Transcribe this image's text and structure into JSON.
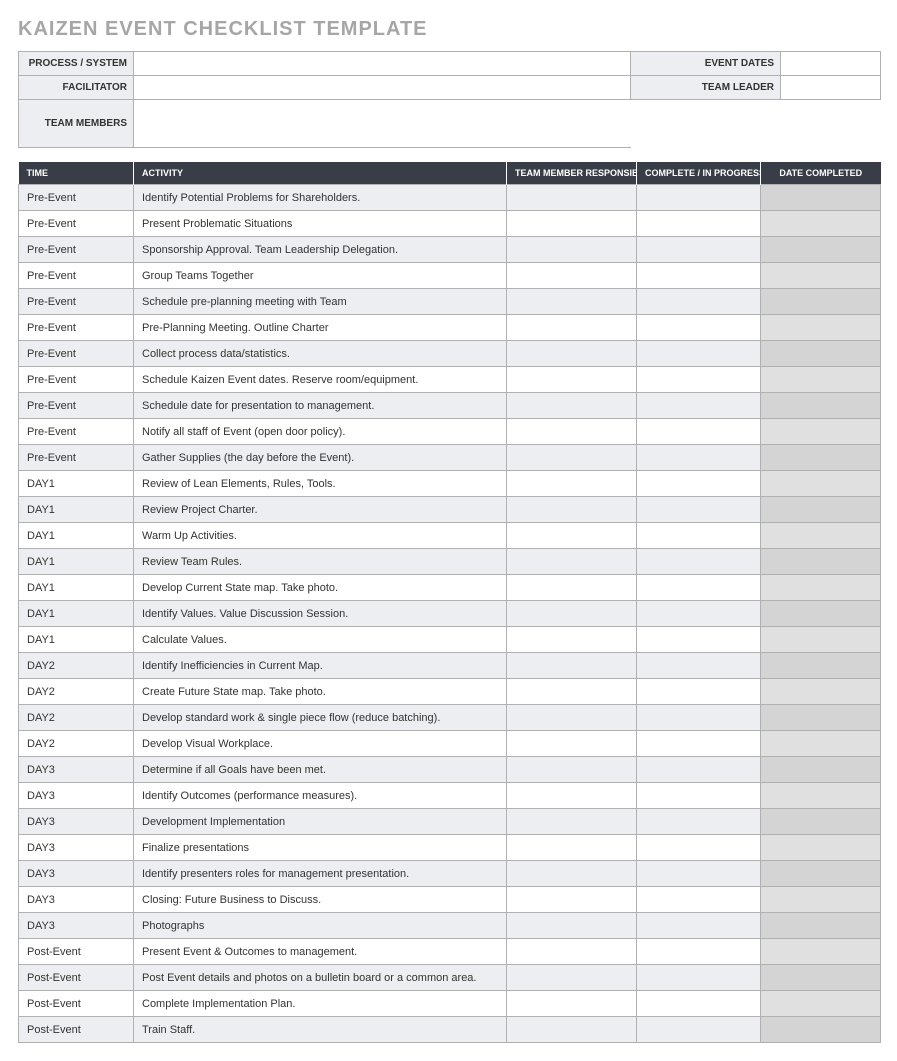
{
  "title": "KAIZEN EVENT CHECKLIST TEMPLATE",
  "info": {
    "labels": {
      "process": "PROCESS / SYSTEM",
      "dates": "EVENT DATES",
      "facilitator": "FACILITATOR",
      "leader": "TEAM LEADER",
      "members": "TEAM MEMBERS"
    },
    "values": {
      "process": "",
      "dates": "",
      "facilitator": "",
      "leader": "",
      "members": ""
    }
  },
  "columns": {
    "time": "TIME",
    "activity": "ACTIVITY",
    "responsible": "TEAM MEMBER RESPONSIBLE",
    "complete": "COMPLETE / IN PROGRESS",
    "date": "DATE COMPLETED"
  },
  "rows": [
    {
      "time": "Pre-Event",
      "activity": "Identify Potential Problems for Shareholders."
    },
    {
      "time": "Pre-Event",
      "activity": "Present Problematic Situations"
    },
    {
      "time": "Pre-Event",
      "activity": "Sponsorship Approval. Team Leadership Delegation."
    },
    {
      "time": "Pre-Event",
      "activity": "Group Teams Together"
    },
    {
      "time": "Pre-Event",
      "activity": "Schedule pre-planning meeting with Team"
    },
    {
      "time": "Pre-Event",
      "activity": "Pre-Planning Meeting. Outline Charter"
    },
    {
      "time": "Pre-Event",
      "activity": "Collect process data/statistics."
    },
    {
      "time": "Pre-Event",
      "activity": "Schedule Kaizen Event dates. Reserve room/equipment."
    },
    {
      "time": "Pre-Event",
      "activity": "Schedule date for presentation to management."
    },
    {
      "time": "Pre-Event",
      "activity": "Notify all staff of Event (open door policy)."
    },
    {
      "time": "Pre-Event",
      "activity": "Gather Supplies (the day before the Event)."
    },
    {
      "time": "DAY1",
      "activity": "Review of Lean Elements, Rules, Tools."
    },
    {
      "time": "DAY1",
      "activity": "Review Project Charter."
    },
    {
      "time": "DAY1",
      "activity": "Warm Up Activities."
    },
    {
      "time": "DAY1",
      "activity": "Review Team Rules."
    },
    {
      "time": "DAY1",
      "activity": "Develop Current State map. Take photo."
    },
    {
      "time": "DAY1",
      "activity": "Identify Values. Value Discussion Session."
    },
    {
      "time": "DAY1",
      "activity": "Calculate Values."
    },
    {
      "time": "DAY2",
      "activity": "Identify Inefficiencies in Current Map."
    },
    {
      "time": "DAY2",
      "activity": "Create Future State map. Take photo."
    },
    {
      "time": "DAY2",
      "activity": "Develop standard work & single piece flow (reduce batching)."
    },
    {
      "time": "DAY2",
      "activity": "Develop Visual Workplace."
    },
    {
      "time": "DAY3",
      "activity": "Determine if all Goals have been met."
    },
    {
      "time": "DAY3",
      "activity": "Identify Outcomes (performance measures)."
    },
    {
      "time": "DAY3",
      "activity": "Development Implementation"
    },
    {
      "time": "DAY3",
      "activity": "Finalize presentations"
    },
    {
      "time": "DAY3",
      "activity": "Identify presenters roles for management presentation."
    },
    {
      "time": "DAY3",
      "activity": "Closing: Future Business to Discuss."
    },
    {
      "time": "DAY3",
      "activity": "Photographs"
    },
    {
      "time": "Post-Event",
      "activity": "Present Event & Outcomes to management."
    },
    {
      "time": "Post-Event",
      "activity": "Post Event details and photos on a bulletin board or a common area."
    },
    {
      "time": "Post-Event",
      "activity": "Complete Implementation Plan."
    },
    {
      "time": "Post-Event",
      "activity": "Train Staff."
    }
  ]
}
